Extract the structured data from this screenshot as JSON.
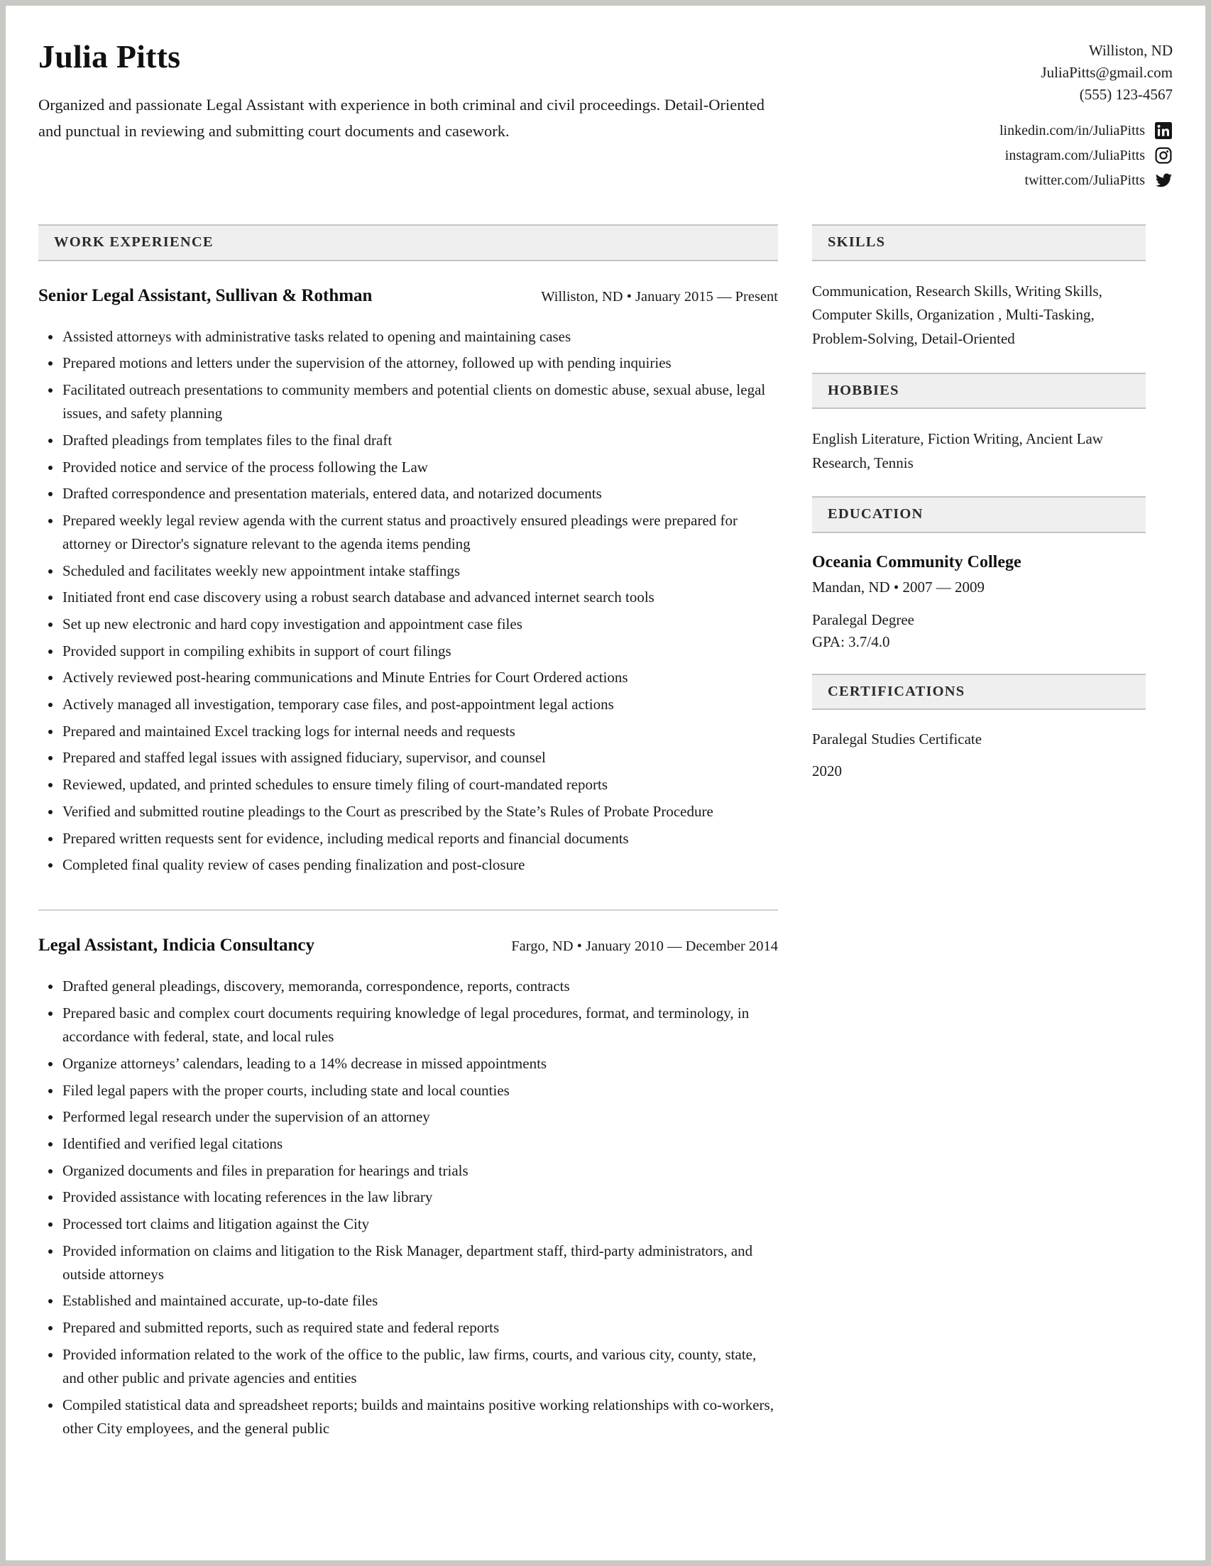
{
  "profile": {
    "name": "Julia Pitts",
    "summary": "Organized and passionate Legal Assistant with experience in both criminal and civil proceedings. Detail-Oriented and punctual in reviewing and submitting court documents and casework."
  },
  "contact": {
    "location": "Williston, ND",
    "email": "JuliaPitts@gmail.com",
    "phone": "(555) 123-4567",
    "socials": [
      {
        "icon": "linkedin-icon",
        "text": "linkedin.com/in/JuliaPitts"
      },
      {
        "icon": "instagram-icon",
        "text": "instagram.com/JuliaPitts"
      },
      {
        "icon": "twitter-icon",
        "text": "twitter.com/JuliaPitts"
      }
    ]
  },
  "sections": {
    "work_experience": "WORK EXPERIENCE",
    "skills": "SKILLS",
    "hobbies": "HOBBIES",
    "education": "EDUCATION",
    "certifications": "CERTIFICATIONS"
  },
  "jobs": [
    {
      "title": "Senior Legal Assistant, Sullivan & Rothman",
      "meta": "Williston, ND • January 2015 — Present",
      "bullets": [
        "Assisted attorneys with administrative tasks related to opening and maintaining cases",
        "Prepared motions and letters under the supervision of the attorney, followed up with pending inquiries",
        "Facilitated outreach presentations to community members and potential clients on domestic abuse, sexual abuse, legal issues, and safety planning",
        "Drafted pleadings from templates files to the final draft",
        "Provided notice and service of the process following the Law",
        "Drafted correspondence and presentation materials, entered data, and notarized documents",
        "Prepared weekly legal review agenda with the current status and proactively ensured pleadings were prepared for attorney or Director's signature relevant to the agenda items pending",
        "Scheduled and facilitates weekly new appointment intake staffings",
        "Initiated front end case discovery using a robust search database and advanced internet search tools",
        "Set up new electronic and hard copy investigation and appointment case files",
        "Provided support in compiling exhibits in support of court filings",
        "Actively reviewed post-hearing communications and Minute Entries for Court Ordered actions",
        "Actively managed all investigation, temporary case files, and post-appointment legal actions",
        "Prepared and maintained Excel tracking logs for internal needs and requests",
        "Prepared and staffed legal issues with assigned fiduciary, supervisor, and counsel",
        "Reviewed, updated, and printed schedules to ensure timely filing of court-mandated reports",
        "Verified and submitted routine pleadings to the Court as prescribed by the State’s Rules of Probate Procedure",
        "Prepared written requests sent for evidence, including medical reports and financial documents",
        "Completed final quality review of cases pending finalization and post-closure"
      ]
    },
    {
      "title": "Legal Assistant, Indicia Consultancy",
      "meta": "Fargo, ND • January 2010 — December 2014",
      "bullets": [
        "Drafted general pleadings, discovery, memoranda, correspondence, reports, contracts",
        "Prepared basic and complex court documents requiring knowledge of legal procedures, format, and terminology, in accordance with federal, state, and local rules",
        "Organize attorneys’ calendars, leading to a 14% decrease in missed appointments",
        "Filed legal papers with the proper courts, including state and local counties",
        "Performed legal research under the supervision of an attorney",
        "Identified and verified legal citations",
        "Organized documents and files in preparation for hearings and trials",
        "Provided assistance with locating references in the law library",
        "Processed tort claims and litigation against the City",
        "Provided information on claims and litigation to the Risk Manager, department staff, third-party administrators, and outside attorneys",
        "Established and maintained accurate, up-to-date files",
        "Prepared and submitted reports, such as required state and federal reports",
        "Provided information related to the work of the office to the public, law firms, courts, and various city, county, state, and other public and private agencies and entities",
        "Compiled statistical data and spreadsheet reports; builds and maintains positive working relationships with co-workers, other City employees, and the general public"
      ]
    }
  ],
  "skills_text": "Communication, Research Skills, Writing Skills, Computer Skills, Organization , Multi-Tasking, Problem-Solving, Detail-Oriented",
  "hobbies_text": "English Literature, Fiction Writing, Ancient Law Research, Tennis",
  "education": {
    "school": "Oceania Community College",
    "meta": "Mandan, ND • 2007 — 2009",
    "degree": "Paralegal Degree",
    "gpa": "GPA: 3.7/4.0"
  },
  "certifications": {
    "name": "Paralegal Studies Certificate",
    "year": "2020"
  },
  "colors": {
    "section_bar_bg": "#efefef",
    "section_bar_border": "#c3c3c3",
    "text": "#1a1a1a",
    "page_bg": "#c9c8c4"
  }
}
